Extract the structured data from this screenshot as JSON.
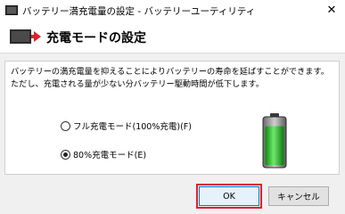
{
  "window": {
    "title": "バッテリー満充電量の設定 - バッテリーユーティリティ",
    "close_glyph": "✕"
  },
  "header": {
    "title": "充電モードの設定",
    "icon": "battery-charge-arrow-icon"
  },
  "description": "バッテリーの満充電量を抑えることによりバッテリーの寿命を延ばすことができます。ただし、充電される量が少ない分バッテリー駆動時間が低下します。",
  "options": [
    {
      "label": "フル充電モード(100%充電)(F)",
      "selected": false
    },
    {
      "label": "80%充電モード(E)",
      "selected": true
    }
  ],
  "battery": {
    "level": 0.8,
    "color": "#22c022"
  },
  "buttons": {
    "ok": "OK",
    "cancel": "キャンセル"
  },
  "colors": {
    "highlight": "#e0202e",
    "focus": "#0078d7"
  }
}
